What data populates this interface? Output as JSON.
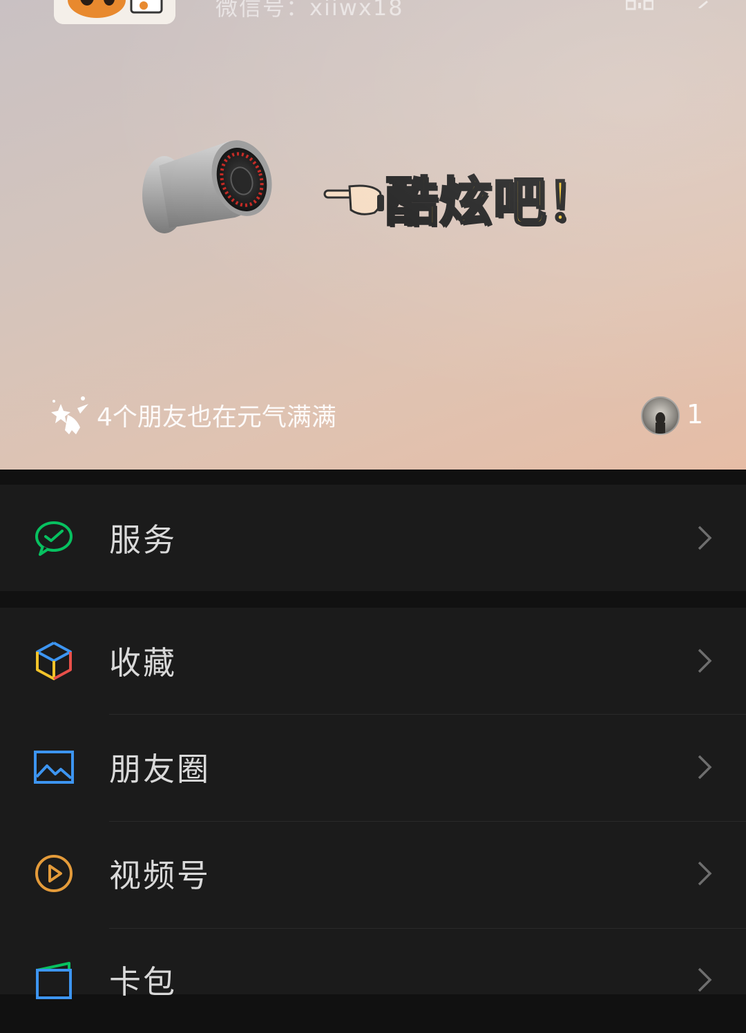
{
  "header": {
    "wechat_id": "微信号：xiiwx18",
    "status_text": "酷炫吧！",
    "friends_text": "4个朋友也在元气满满",
    "friend_count": "1"
  },
  "menu": {
    "services": {
      "label": "服务",
      "icon": "wechat-pay-icon"
    },
    "favorites": {
      "label": "收藏",
      "icon": "cube-icon"
    },
    "moments": {
      "label": "朋友圈",
      "icon": "picture-icon"
    },
    "channels": {
      "label": "视频号",
      "icon": "play-circle-icon"
    },
    "cards": {
      "label": "卡包",
      "icon": "wallet-icon"
    }
  },
  "colors": {
    "background": "#111111",
    "row": "#1b1b1b",
    "green": "#07c160",
    "blue": "#3d95f1",
    "orange": "#e49b3a",
    "sticker_yellow": "#f2c32a"
  }
}
